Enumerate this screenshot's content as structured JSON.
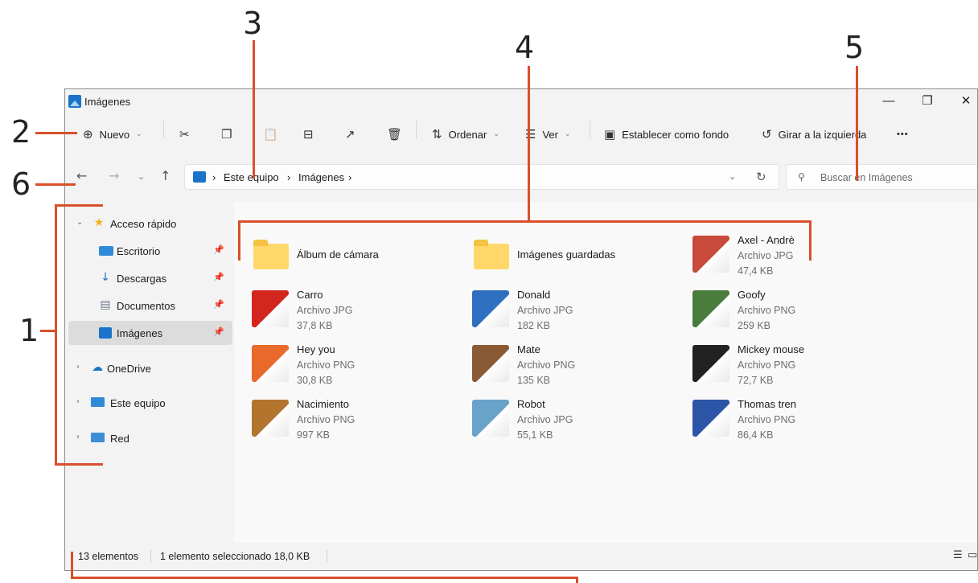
{
  "callouts": [
    "1",
    "2",
    "3",
    "4",
    "5",
    "6"
  ],
  "window": {
    "title": "Imágenes",
    "controls": {
      "minimize": "—",
      "restore": "❐",
      "close": "✕"
    }
  },
  "toolbar": {
    "new_label": "Nuevo",
    "sort_label": "Ordenar",
    "view_label": "Ver",
    "set_background_label": "Establecer como fondo",
    "rotate_left_label": "Girar a la izquierda",
    "more_label": "•••",
    "icons": [
      "cut-icon",
      "copy-icon",
      "paste-icon",
      "rename-icon",
      "share-icon",
      "delete-icon"
    ]
  },
  "address": {
    "crumbs": [
      "Este equipo",
      "Imágenes"
    ],
    "separator": "›"
  },
  "search": {
    "placeholder": "Buscar en Imágenes"
  },
  "sidebar": {
    "quick_access": "Acceso rápido",
    "items": [
      {
        "label": "Escritorio"
      },
      {
        "label": "Descargas"
      },
      {
        "label": "Documentos"
      },
      {
        "label": "Imágenes"
      }
    ],
    "onedrive": "OneDrive",
    "this_pc": "Este equipo",
    "network": "Red"
  },
  "files": [
    {
      "name": "Álbum de cámara",
      "kind": "folder"
    },
    {
      "name": "Imágenes guardadas",
      "kind": "folder"
    },
    {
      "name": "Axel - Andrè",
      "type": "Archivo JPG",
      "size": "47,4 KB",
      "color": "#c74a3a"
    },
    {
      "name": "Carro",
      "type": "Archivo JPG",
      "size": "37,8 KB",
      "color": "#d3261f"
    },
    {
      "name": "Donald",
      "type": "Archivo JPG",
      "size": "182 KB",
      "color": "#2f6fbf"
    },
    {
      "name": "Goofy",
      "type": "Archivo PNG",
      "size": "259 KB",
      "color": "#4a7d3c"
    },
    {
      "name": "Hey you",
      "type": "Archivo PNG",
      "size": "30,8 KB",
      "color": "#e8692a"
    },
    {
      "name": "Mate",
      "type": "Archivo PNG",
      "size": "135 KB",
      "color": "#8a5a35"
    },
    {
      "name": "Mickey mouse",
      "type": "Archivo PNG",
      "size": "72,7 KB",
      "color": "#222222"
    },
    {
      "name": "Nacimiento",
      "type": "Archivo PNG",
      "size": "997 KB",
      "color": "#b3742e"
    },
    {
      "name": "Robot",
      "type": "Archivo JPG",
      "size": "55,1 KB",
      "color": "#6aa3c9"
    },
    {
      "name": "Thomas tren",
      "type": "Archivo PNG",
      "size": "86,4 KB",
      "color": "#2c55a8"
    }
  ],
  "status": {
    "count": "13 elementos",
    "selection": "1 elemento seleccionado  18,0 KB"
  },
  "colors": {
    "accent": "#1a73c8",
    "callout_line": "#d9502a",
    "folder": "#ffd76a"
  }
}
